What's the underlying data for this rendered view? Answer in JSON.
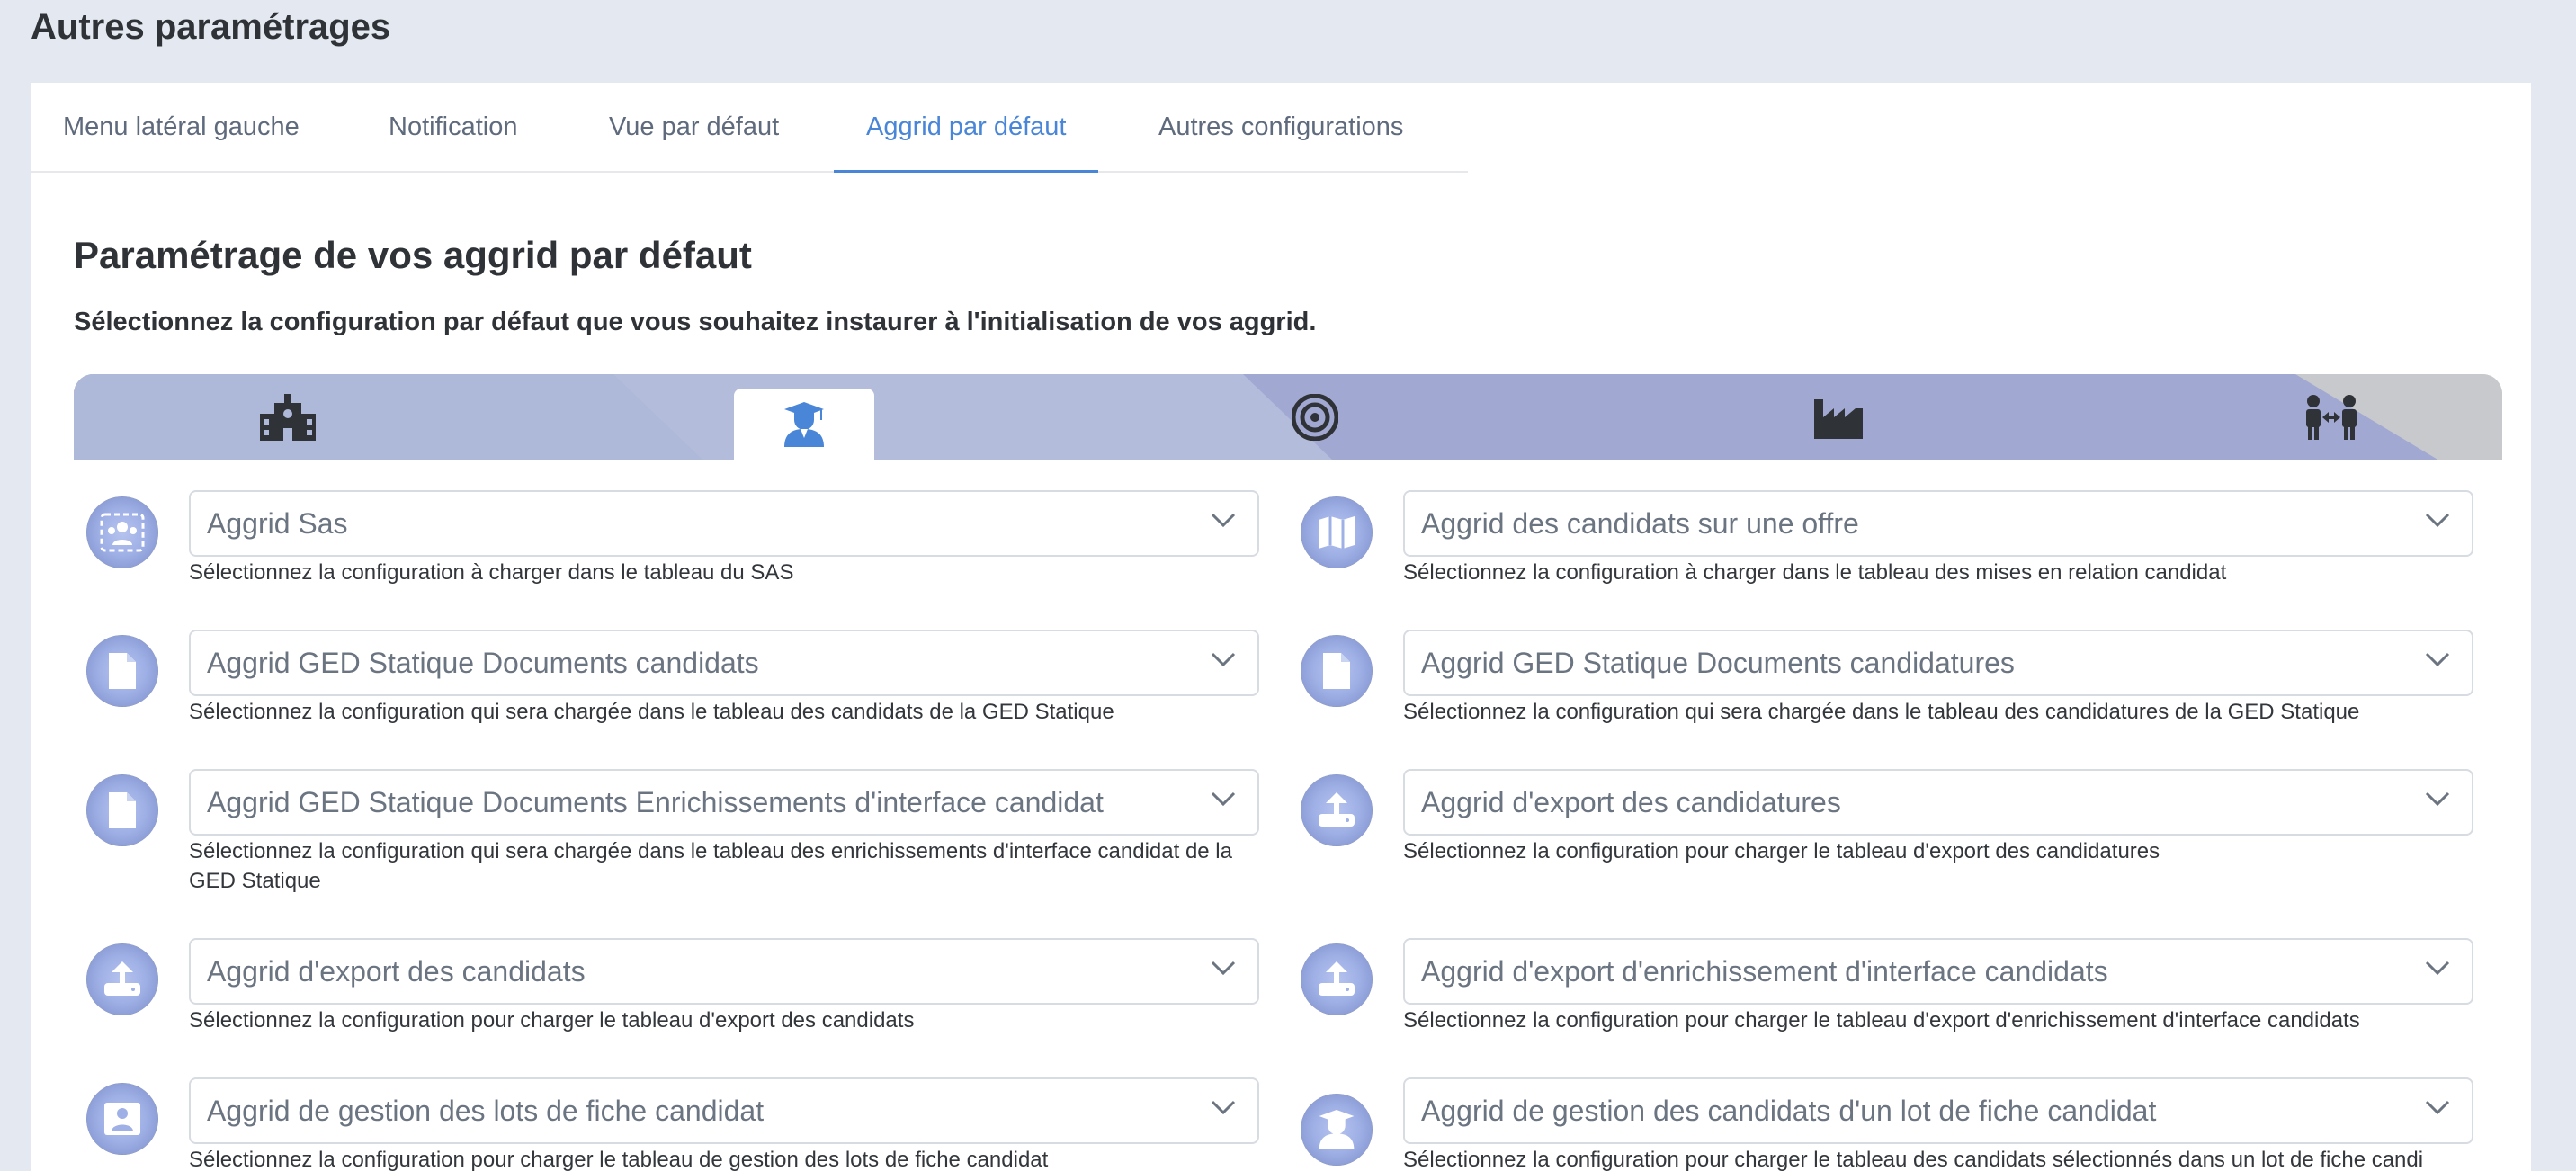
{
  "page_title": "Autres paramétrages",
  "tabs": [
    {
      "label": "Menu latéral gauche"
    },
    {
      "label": "Notification"
    },
    {
      "label": "Vue par défaut"
    },
    {
      "label": "Aggrid par défaut",
      "active": true
    },
    {
      "label": "Autres configurations"
    }
  ],
  "section": {
    "title": "Paramétrage de vos aggrid par défaut",
    "description": "Sélectionnez la configuration par défaut que vous souhaitez instaurer à l'initialisation de vos aggrid."
  },
  "category_tabs": [
    {
      "icon": "school-building-icon"
    },
    {
      "icon": "graduate-student-icon",
      "active": true
    },
    {
      "icon": "target-icon"
    },
    {
      "icon": "factory-icon"
    },
    {
      "icon": "people-exchange-icon"
    }
  ],
  "fields": [
    {
      "icon": "group-icon",
      "value": "Aggrid Sas",
      "help": "Sélectionnez la configuration à charger dans le tableau du SAS"
    },
    {
      "icon": "map-icon",
      "value": "Aggrid des candidats sur une offre",
      "help": "Sélectionnez la configuration à charger dans le tableau des mises en relation candidat"
    },
    {
      "icon": "document-icon",
      "value": "Aggrid GED Statique Documents candidats",
      "help": "Sélectionnez la configuration qui sera chargée dans le tableau des candidats de la GED Statique"
    },
    {
      "icon": "document-icon",
      "value": "Aggrid GED Statique Documents candidatures",
      "help": "Sélectionnez la configuration qui sera chargée dans le tableau des candidatures de la GED Statique"
    },
    {
      "icon": "document-icon",
      "value": "Aggrid GED Statique Documents Enrichissements d'interface candidat",
      "help": "Sélectionnez la configuration qui sera chargée dans le tableau des enrichissements d'interface candidat de la GED Statique"
    },
    {
      "icon": "upload-icon",
      "value": "Aggrid d'export des candidatures",
      "help": "Sélectionnez la configuration pour charger le tableau d'export des candidatures"
    },
    {
      "icon": "upload-icon",
      "value": "Aggrid d'export des candidats",
      "help": "Sélectionnez la configuration pour charger le tableau d'export des candidats"
    },
    {
      "icon": "upload-icon",
      "value": "Aggrid d'export d'enrichissement d'interface candidats",
      "help": "Sélectionnez la configuration pour charger le tableau d'export d'enrichissement d'interface candidats"
    },
    {
      "icon": "user-card-icon",
      "value": "Aggrid de gestion des lots de fiche candidat",
      "help": "Sélectionnez la configuration pour charger le tableau de gestion des lots de fiche candidat"
    },
    {
      "icon": "student-icon",
      "value": "Aggrid de gestion des candidats d'un lot de fiche candidat",
      "help": "Sélectionnez la configuration pour charger le tableau des candidats sélectionnés dans un lot de fiche candi"
    }
  ],
  "colors": {
    "accent": "#4a86d8",
    "icon_dark": "#2f3236",
    "band_light": "#b3bcda",
    "band_mid": "#a1a9d3",
    "band_grey": "#c8c9cc"
  }
}
